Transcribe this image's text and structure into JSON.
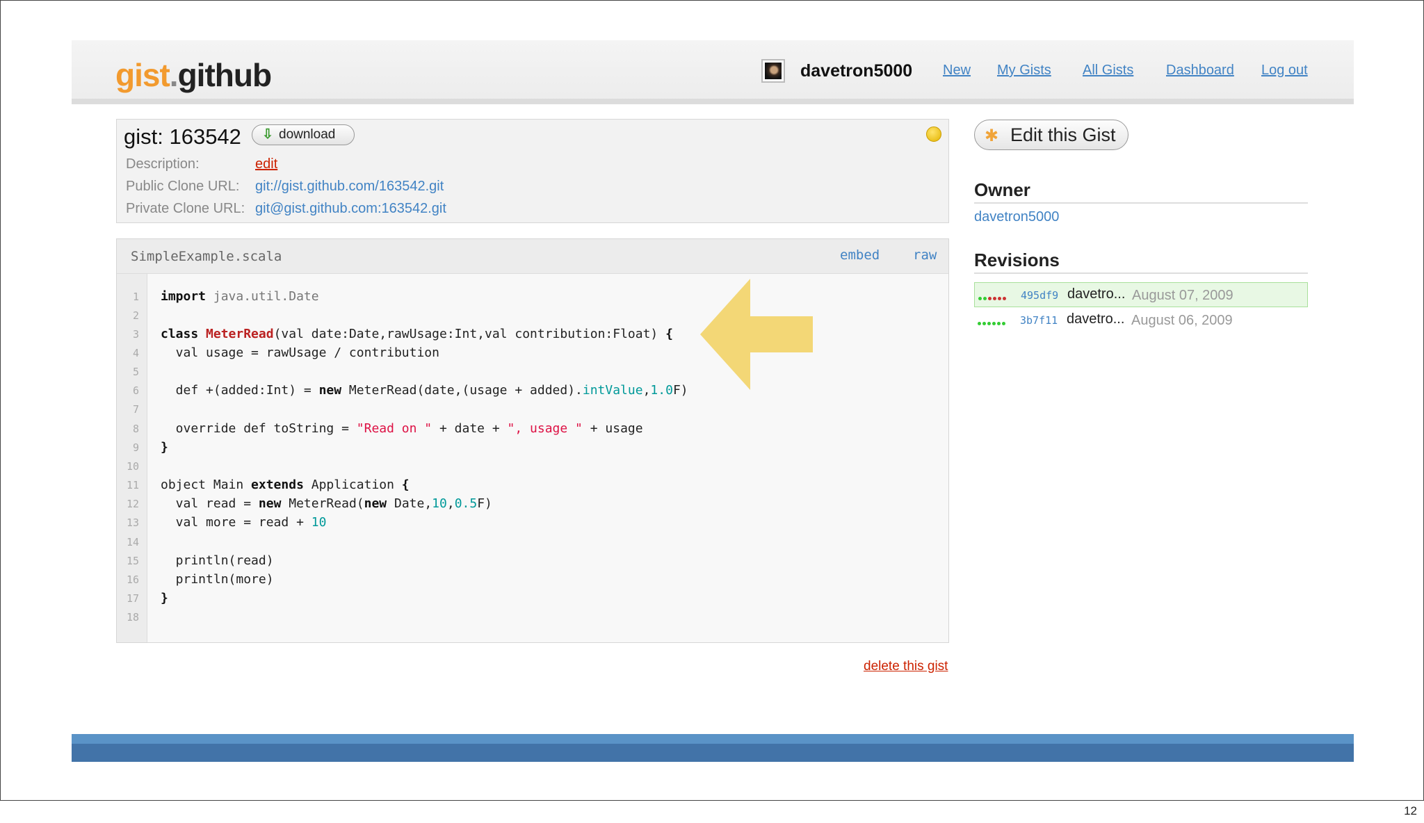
{
  "header": {
    "logo_gist": "gist",
    "logo_dot": ".",
    "logo_github": "github",
    "username": "davetron5000",
    "nav": [
      "New",
      "My Gists",
      "All Gists",
      "Dashboard",
      "Log out"
    ]
  },
  "gist": {
    "title": "gist: 163542",
    "download_label": "download",
    "description_label": "Description:",
    "description_value": "edit",
    "public_clone_label": "Public Clone URL:",
    "public_clone_url": "git://gist.github.com/163542.git",
    "private_clone_label": "Private Clone URL:",
    "private_clone_url": "git@gist.github.com:163542.git"
  },
  "file": {
    "name": "SimpleExample.scala",
    "embed_label": "embed",
    "raw_label": "raw",
    "line_numbers": [
      "1",
      "2",
      "3",
      "4",
      "5",
      "6",
      "7",
      "8",
      "9",
      "10",
      "11",
      "12",
      "13",
      "14",
      "15",
      "16",
      "17",
      "18"
    ]
  },
  "delete_label": "delete this gist",
  "sidebar": {
    "edit_label": "Edit this Gist",
    "owner_heading": "Owner",
    "owner_name": "davetron5000",
    "revisions_heading": "Revisions",
    "revisions": [
      {
        "hash": "495df9",
        "user": "davetro...",
        "date": "August 07, 2009"
      },
      {
        "hash": "3b7f11",
        "user": "davetro...",
        "date": "August 06, 2009"
      }
    ]
  },
  "slide_number": "12",
  "colors": {
    "link": "#4183c4",
    "logo_orange": "#f29a2e",
    "danger": "#cc2200",
    "arrow": "#f2d46a",
    "footer": "#4273a8"
  }
}
